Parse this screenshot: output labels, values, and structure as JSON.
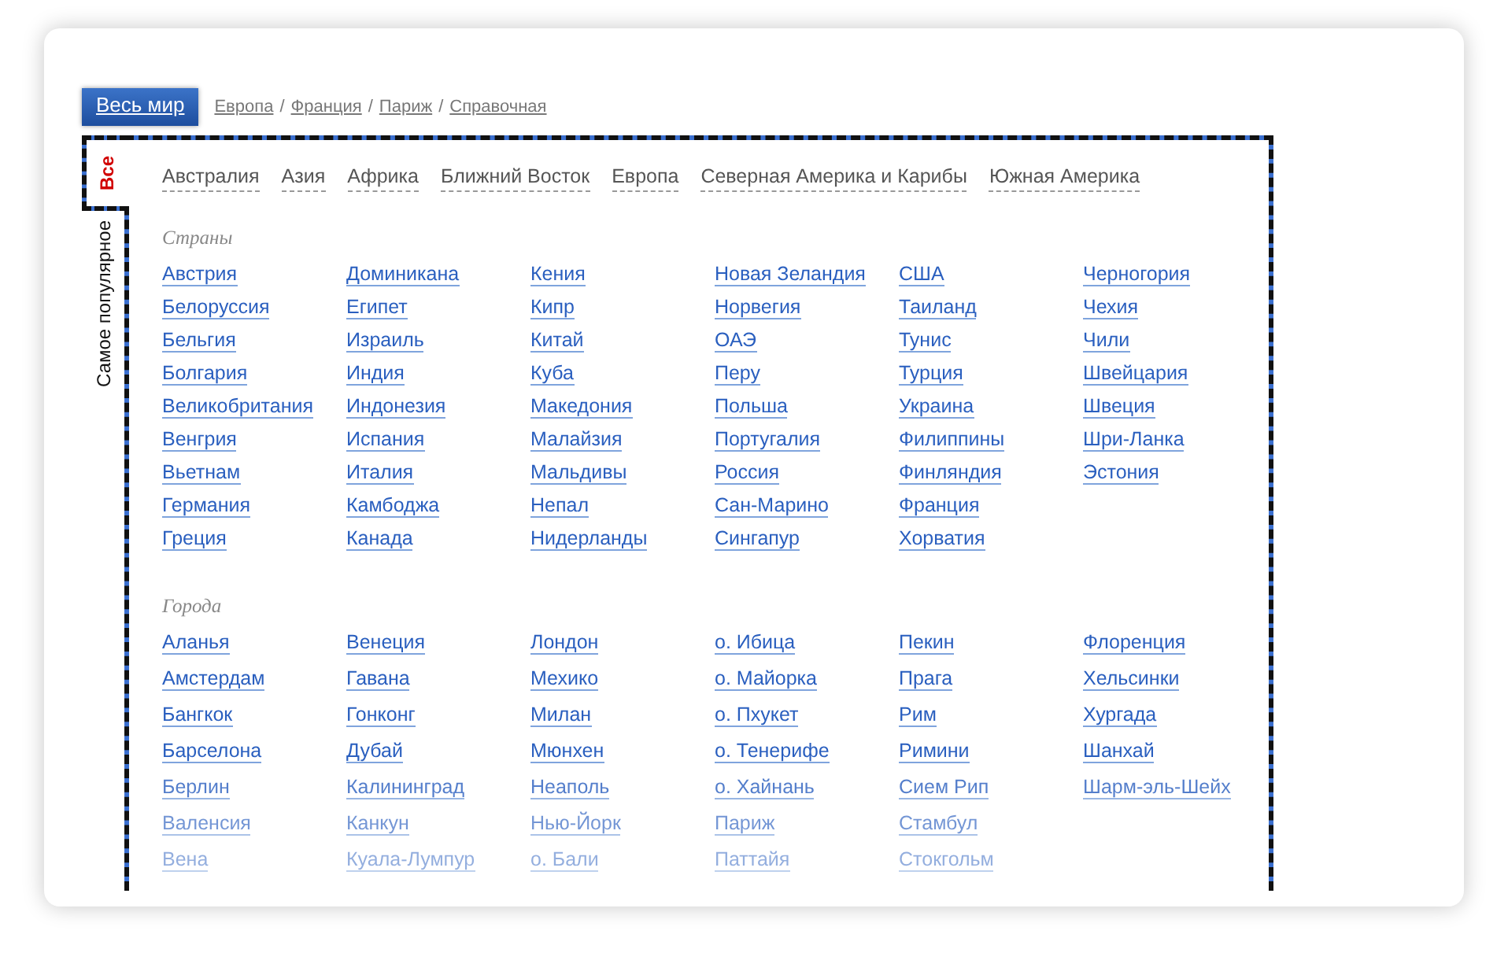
{
  "top_tabs": [
    {
      "label": "Весь мир",
      "selected": true
    }
  ],
  "breadcrumb": [
    {
      "kind": "link",
      "text": "Европа"
    },
    {
      "kind": "separator",
      "text": "/"
    },
    {
      "kind": "link",
      "text": "Франция"
    },
    {
      "kind": "separator",
      "text": "/"
    },
    {
      "kind": "link",
      "text": "Париж"
    },
    {
      "kind": "separator",
      "text": "/"
    },
    {
      "kind": "link",
      "text": "Справочная"
    }
  ],
  "side_tabs": [
    {
      "label": "Все",
      "selected": true
    },
    {
      "label": "Самое популярное",
      "selected": false
    }
  ],
  "regions": [
    "Австралия",
    "Азия",
    "Африка",
    "Ближний Восток",
    "Европа",
    "Северная Америка и Карибы",
    "Южная Америка"
  ],
  "sections": [
    {
      "title": "Страны",
      "columns": [
        [
          "Австрия",
          "Белоруссия",
          "Бельгия",
          "Болгария",
          "Великобритания",
          "Венгрия",
          "Вьетнам",
          "Германия",
          "Греция"
        ],
        [
          "Доминикана",
          "Египет",
          "Израиль",
          "Индия",
          "Индонезия",
          "Испания",
          "Италия",
          "Камбоджа",
          "Канада"
        ],
        [
          "Кения",
          "Кипр",
          "Китай",
          "Куба",
          "Македония",
          "Малайзия",
          "Мальдивы",
          "Непал",
          "Нидерланды"
        ],
        [
          "Новая Зеландия",
          "Норвегия",
          "ОАЭ",
          "Перу",
          "Польша",
          "Португалия",
          "Россия",
          "Сан-Марино",
          "Сингапур"
        ],
        [
          "США",
          "Таиланд",
          "Тунис",
          "Турция",
          "Украина",
          "Филиппины",
          "Финляндия",
          "Франция",
          "Хорватия"
        ],
        [
          "Черногория",
          "Чехия",
          "Чили",
          "Швейцария",
          "Швеция",
          "Шри-Ланка",
          "Эстония"
        ]
      ]
    },
    {
      "title": "Города",
      "columns": [
        [
          "Аланья",
          "Амстердам",
          "Бангкок",
          "Барселона",
          "Берлин",
          "Валенсия",
          "Вена"
        ],
        [
          "Венеция",
          "Гавана",
          "Гонконг",
          "Дубай",
          "Калининград",
          "Канкун",
          "Куала-Лумпур"
        ],
        [
          "Лондон",
          "Мехико",
          "Милан",
          "Мюнхен",
          "Неаполь",
          "Нью-Йорк",
          "о. Бали"
        ],
        [
          "о. Ибица",
          "о. Майорка",
          "о. Пхукет",
          "о. Тенерифе",
          "о. Хайнань",
          "Париж",
          "Паттайя"
        ],
        [
          "Пекин",
          "Прага",
          "Рим",
          "Римини",
          "Сием Рип",
          "Стамбул",
          "Стокгольм"
        ],
        [
          "Флоренция",
          "Хельсинки",
          "Хургада",
          "Шанхай",
          "Шарм-эль-Шейх"
        ]
      ]
    }
  ]
}
